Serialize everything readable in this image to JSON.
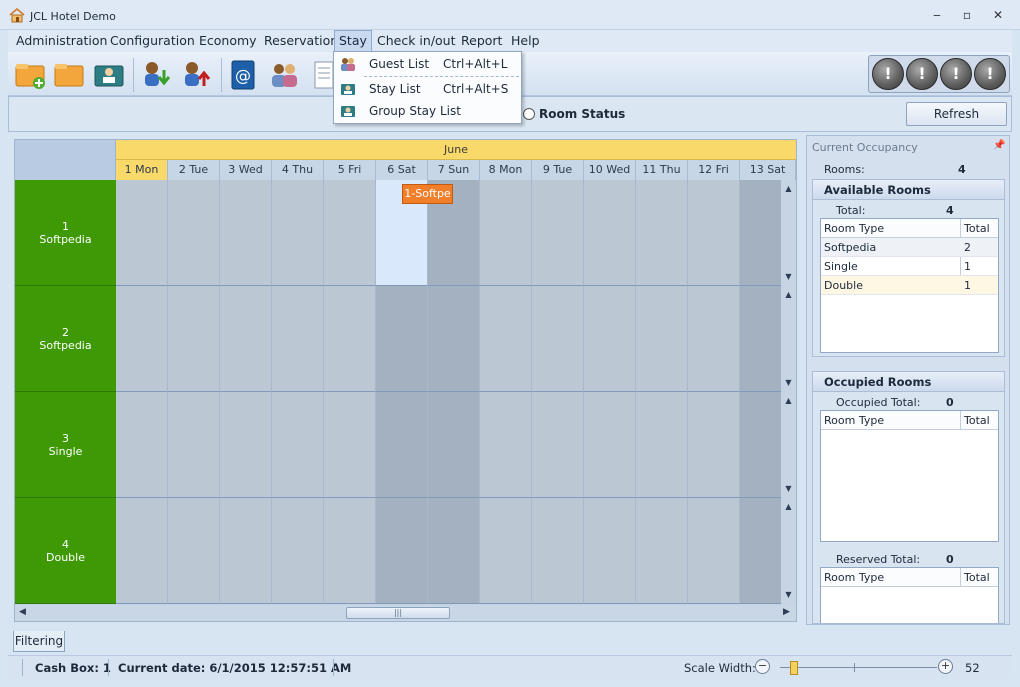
{
  "window": {
    "title": "JCL Hotel Demo",
    "minimize": "‒",
    "maximize": "▫",
    "close": "✕"
  },
  "menu": {
    "items": [
      "Administration",
      "Configuration",
      "Economy",
      "Reservation",
      "Stay",
      "Check in/out",
      "Report",
      "Help"
    ],
    "active": "Stay"
  },
  "stay_menu": {
    "items": [
      {
        "label": "Guest List",
        "shortcut": "Ctrl+Alt+L",
        "icon": "guests-icon"
      },
      {
        "label": "Stay List",
        "shortcut": "Ctrl+Alt+S",
        "icon": "stay-list-icon"
      },
      {
        "label": "Group Stay List",
        "shortcut": "",
        "icon": "group-stay-icon"
      }
    ]
  },
  "toolbar": {
    "alert_symbol": "!"
  },
  "filterbar": {
    "room_status_label": "Room Status",
    "refresh_label": "Refresh"
  },
  "calendar": {
    "month": "June",
    "days": [
      "1 Mon",
      "2 Tue",
      "3 Wed",
      "4 Thu",
      "5 Fri",
      "6 Sat",
      "7 Sun",
      "8 Mon",
      "9 Tue",
      "10 Wed",
      "11 Thu",
      "12 Fri",
      "13 Sat"
    ],
    "rooms": [
      {
        "number": "1",
        "type": "Softpedia"
      },
      {
        "number": "2",
        "type": "Softpedia"
      },
      {
        "number": "3",
        "type": "Single"
      },
      {
        "number": "4",
        "type": "Double"
      }
    ],
    "booking_label": "1-Softpe",
    "grip": "|||"
  },
  "occupancy": {
    "title": "Current Occupancy",
    "rooms_label": "Rooms:",
    "rooms_value": "4",
    "available": {
      "title": "Available Rooms",
      "total_label": "Total:",
      "total_value": "4",
      "columns": [
        "Room Type",
        "Total"
      ],
      "rows": [
        {
          "type": "Softpedia",
          "total": "2"
        },
        {
          "type": "Single",
          "total": "1"
        },
        {
          "type": "Double",
          "total": "1"
        }
      ]
    },
    "occupied": {
      "title": "Occupied Rooms",
      "total_label": "Occupied Total:",
      "total_value": "0",
      "columns": [
        "Room Type",
        "Total"
      ]
    },
    "reserved": {
      "total_label": "Reserved Total:",
      "total_value": "0",
      "columns": [
        "Room Type",
        "Total"
      ]
    }
  },
  "tab": {
    "filtering": "Filtering"
  },
  "status": {
    "cash_box": "Cash Box: 1",
    "current_date": "Current date: 6/1/2015 12:57:51 AM",
    "scale_label": "Scale Width:",
    "scale_value": "52",
    "zoom_out": "−",
    "zoom_in": "+"
  }
}
